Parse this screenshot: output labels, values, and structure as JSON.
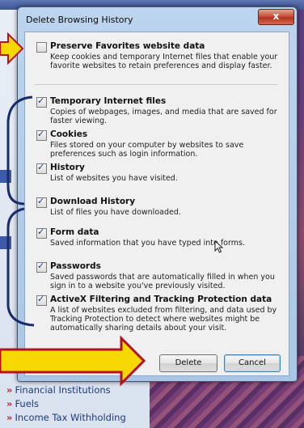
{
  "background": {
    "links": [
      "Financial Institutions",
      "Fuels",
      "Income Tax Withholding"
    ]
  },
  "dialog": {
    "title": "Delete Browsing History",
    "close_label": "x",
    "options": [
      {
        "label": "Preserve Favorites website data",
        "checked": false,
        "description": "Keep cookies and temporary Internet files that enable your favorite websites to retain preferences and display faster."
      },
      {
        "label": "Temporary Internet files",
        "checked": true,
        "description": "Copies of webpages, images, and media that are saved for faster viewing."
      },
      {
        "label": "Cookies",
        "checked": true,
        "description": "Files stored on your computer by websites to save preferences such as login information."
      },
      {
        "label": "History",
        "checked": true,
        "description": "List of websites you have visited."
      },
      {
        "label": "Download History",
        "checked": true,
        "description": "List of files you have downloaded."
      },
      {
        "label": "Form data",
        "checked": true,
        "description": "Saved information that you have typed into forms."
      },
      {
        "label": "Passwords",
        "checked": true,
        "description": "Saved passwords that are automatically filled in when you sign in to a website you've previously visited."
      },
      {
        "label": "ActiveX Filtering and Tracking Protection data",
        "checked": true,
        "description": "A list of websites excluded from filtering, and data used by Tracking Protection to detect where websites might be automatically sharing details about your visit."
      }
    ],
    "buttons": {
      "delete": "Delete",
      "cancel": "Cancel"
    }
  },
  "colors": {
    "arrow_fill": "#f4d800",
    "arrow_stroke": "#b5121b",
    "bracket": "#1a2c6b"
  }
}
